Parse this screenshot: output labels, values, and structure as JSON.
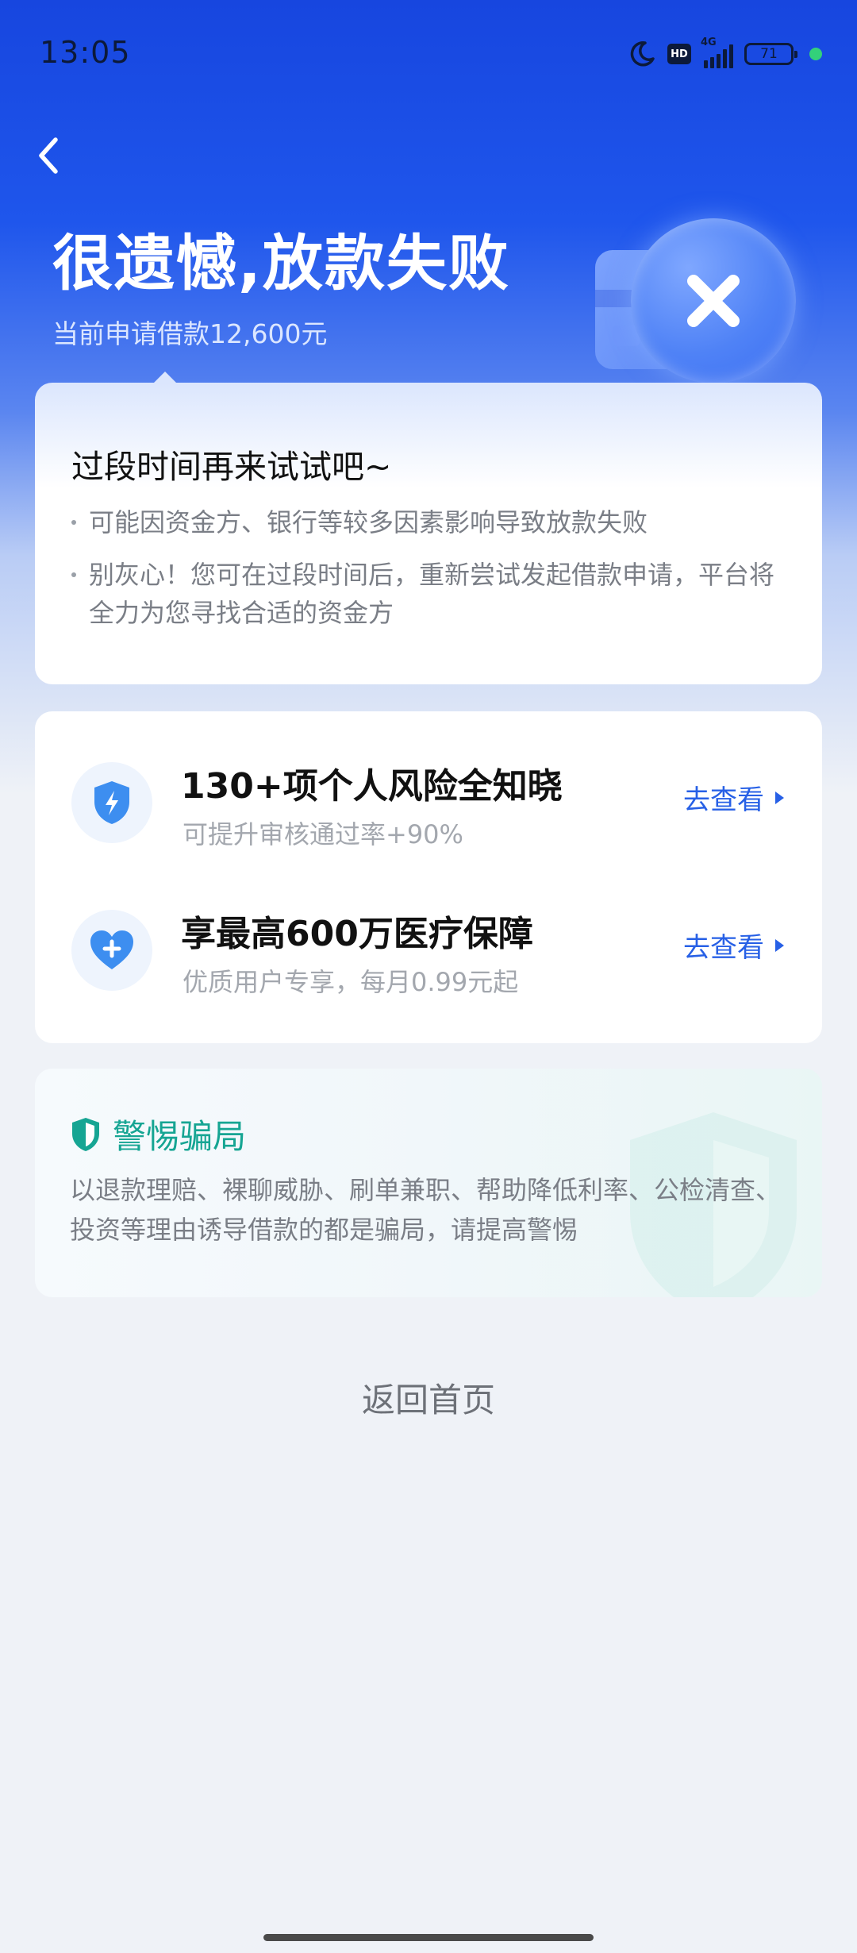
{
  "status_bar": {
    "time": "13:05",
    "network": "4G",
    "battery_level": "71"
  },
  "header": {
    "title": "很遗憾,放款失败",
    "subtitle": "当前申请借款12,600元"
  },
  "tip_card": {
    "title": "过段时间再来试试吧~",
    "lines": [
      "可能因资金方、银行等较多因素影响导致放款失败",
      "别灰心！您可在过段时间后，重新尝试发起借款申请，平台将全力为您寻找合适的资金方"
    ]
  },
  "services": [
    {
      "icon": "lightning-shield-icon",
      "title": "130+项个人风险全知晓",
      "subtitle": "可提升审核通过率+90%",
      "action": "去查看"
    },
    {
      "icon": "heart-plus-icon",
      "title": "享最高600万医疗保障",
      "subtitle": "优质用户专享，每月0.99元起",
      "action": "去查看"
    }
  ],
  "fraud_warning": {
    "icon": "shield-check-icon",
    "title": "警惕骗局",
    "text": "以退款理赔、裸聊威胁、刷单兼职、帮助降低利率、公检清查、投资等理由诱导借款的都是骗局，请提高警惕"
  },
  "footer": {
    "home_label": "返回首页"
  },
  "colors": {
    "brand_blue": "#1f56ec",
    "link_blue": "#2760e6",
    "fraud_green": "#16a593",
    "failure_icon": "#4f82f6"
  }
}
